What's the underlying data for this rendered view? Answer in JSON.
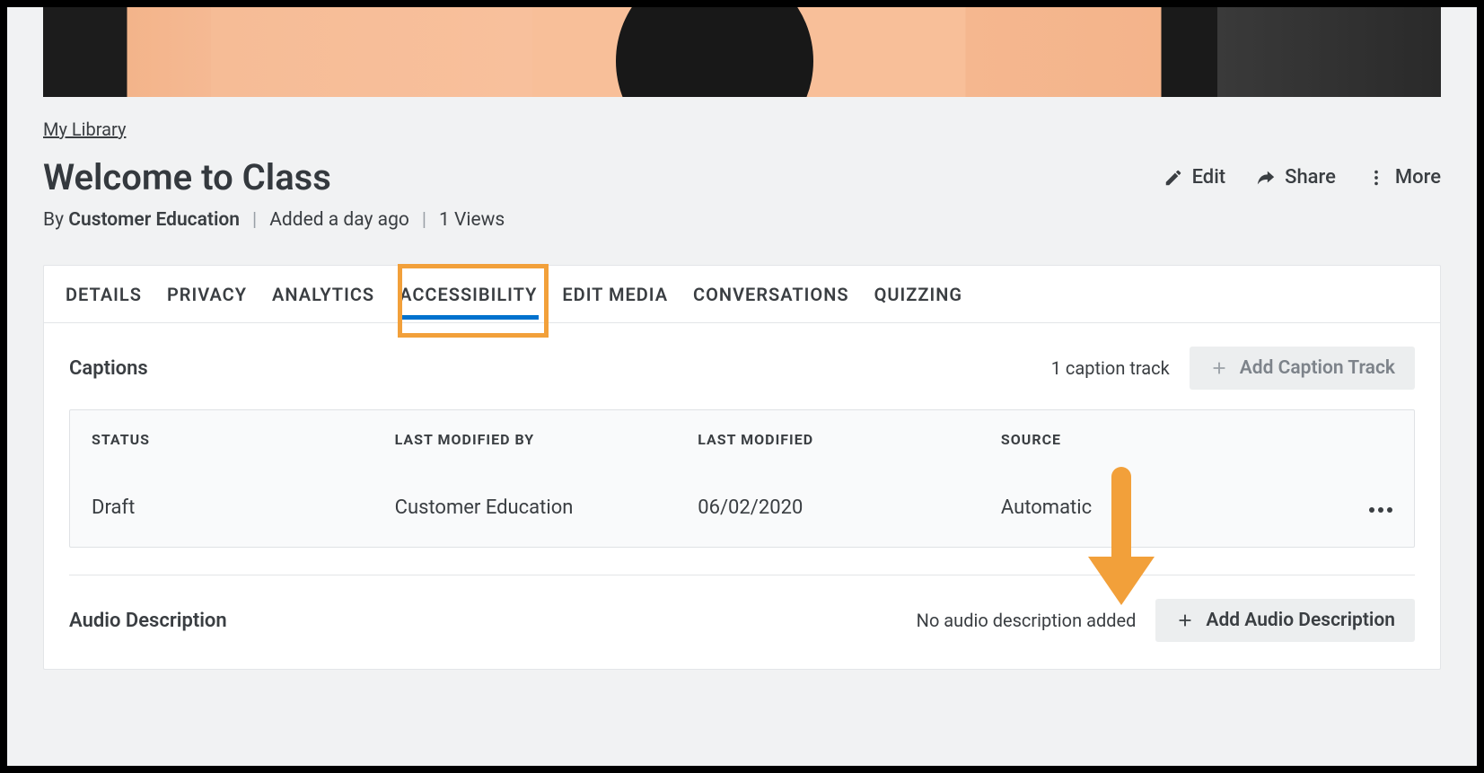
{
  "breadcrumb": {
    "label": "My Library"
  },
  "title": "Welcome to Class",
  "meta": {
    "by_prefix": "By",
    "author": "Customer Education",
    "added": "Added a day ago",
    "views": "1 Views"
  },
  "actions": {
    "edit": "Edit",
    "share": "Share",
    "more": "More"
  },
  "tabs": [
    {
      "label": "Details",
      "active": false
    },
    {
      "label": "Privacy",
      "active": false
    },
    {
      "label": "Analytics",
      "active": false
    },
    {
      "label": "Accessibility",
      "active": true
    },
    {
      "label": "Edit Media",
      "active": false
    },
    {
      "label": "Conversations",
      "active": false
    },
    {
      "label": "Quizzing",
      "active": false
    }
  ],
  "captions": {
    "heading": "Captions",
    "count_label": "1 caption track",
    "add_button": "Add Caption Track",
    "columns": {
      "status": "STATUS",
      "modified_by": "LAST MODIFIED BY",
      "modified": "LAST MODIFIED",
      "source": "SOURCE"
    },
    "rows": [
      {
        "status": "Draft",
        "modified_by": "Customer Education",
        "modified": "06/02/2020",
        "source": "Automatic"
      }
    ]
  },
  "audio": {
    "heading": "Audio Description",
    "empty_text": "No audio description added",
    "add_button": "Add Audio Description"
  }
}
